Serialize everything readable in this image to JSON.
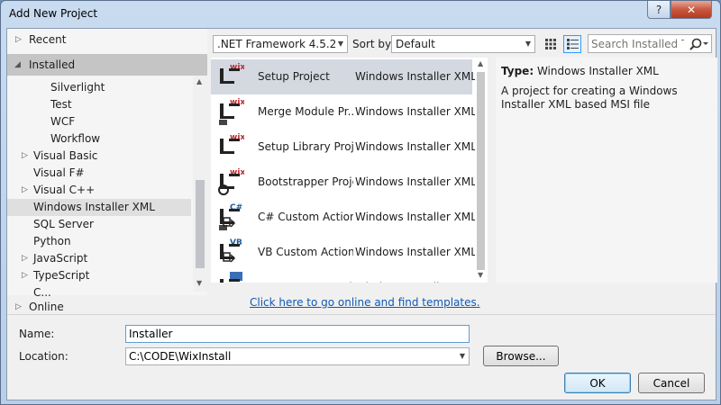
{
  "window": {
    "title": "Add New Project",
    "help": "?",
    "close": "✕"
  },
  "tree": {
    "recent": "Recent",
    "installed": "Installed",
    "online": "Online",
    "items": [
      {
        "label": "Silverlight",
        "arrow": ""
      },
      {
        "label": "Test",
        "arrow": ""
      },
      {
        "label": "WCF",
        "arrow": ""
      },
      {
        "label": "Workflow",
        "arrow": ""
      },
      {
        "label": "Visual Basic",
        "arrow": "▷"
      },
      {
        "label": "Visual F#",
        "arrow": ""
      },
      {
        "label": "Visual C++",
        "arrow": "▷"
      },
      {
        "label": "Windows Installer XML",
        "arrow": ""
      },
      {
        "label": "SQL Server",
        "arrow": ""
      },
      {
        "label": "Python",
        "arrow": ""
      },
      {
        "label": "JavaScript",
        "arrow": "▷"
      },
      {
        "label": "TypeScript",
        "arrow": "▷"
      },
      {
        "label": "C...",
        "arrow": ""
      }
    ],
    "selected_item": "Windows Installer XML"
  },
  "toolbar": {
    "framework": ".NET Framework 4.5.2",
    "sort_label": "Sort by:",
    "sort_value": "Default",
    "search_placeholder": "Search Installed Te",
    "search_icon": "magnifier-icon"
  },
  "templates": [
    {
      "name": "Setup Project",
      "lang": "Windows Installer XML",
      "badge": "wix"
    },
    {
      "name": "Merge Module Pr...",
      "lang": "Windows Installer XML",
      "badge": "wix"
    },
    {
      "name": "Setup Library Proj...",
      "lang": "Windows Installer XML",
      "badge": "wix"
    },
    {
      "name": "Bootstrapper Proje...",
      "lang": "Windows Installer XML",
      "badge": "wix"
    },
    {
      "name": "C# Custom Action...",
      "lang": "Windows Installer XML",
      "badge": "C#"
    },
    {
      "name": "VB Custom Action...",
      "lang": "Windows Installer XML",
      "badge": "VB"
    },
    {
      "name": "C++ Custom Actio...",
      "lang": "Windows Installer XML",
      "badge": ""
    }
  ],
  "details": {
    "type_label": "Type:",
    "type_value": "Windows Installer XML",
    "description": "A project for creating a Windows Installer XML based MSI file"
  },
  "online_link": "Click here to go online and find templates.",
  "form": {
    "name_label": "Name:",
    "name_value": "Installer",
    "location_label": "Location:",
    "location_value": "C:\\CODE\\WixInstall",
    "browse": "Browse...",
    "ok": "OK",
    "cancel": "Cancel"
  },
  "colors": {
    "selection": "#d3d8e1",
    "link": "#0e59b6",
    "wix_badge": "#c0282d"
  }
}
